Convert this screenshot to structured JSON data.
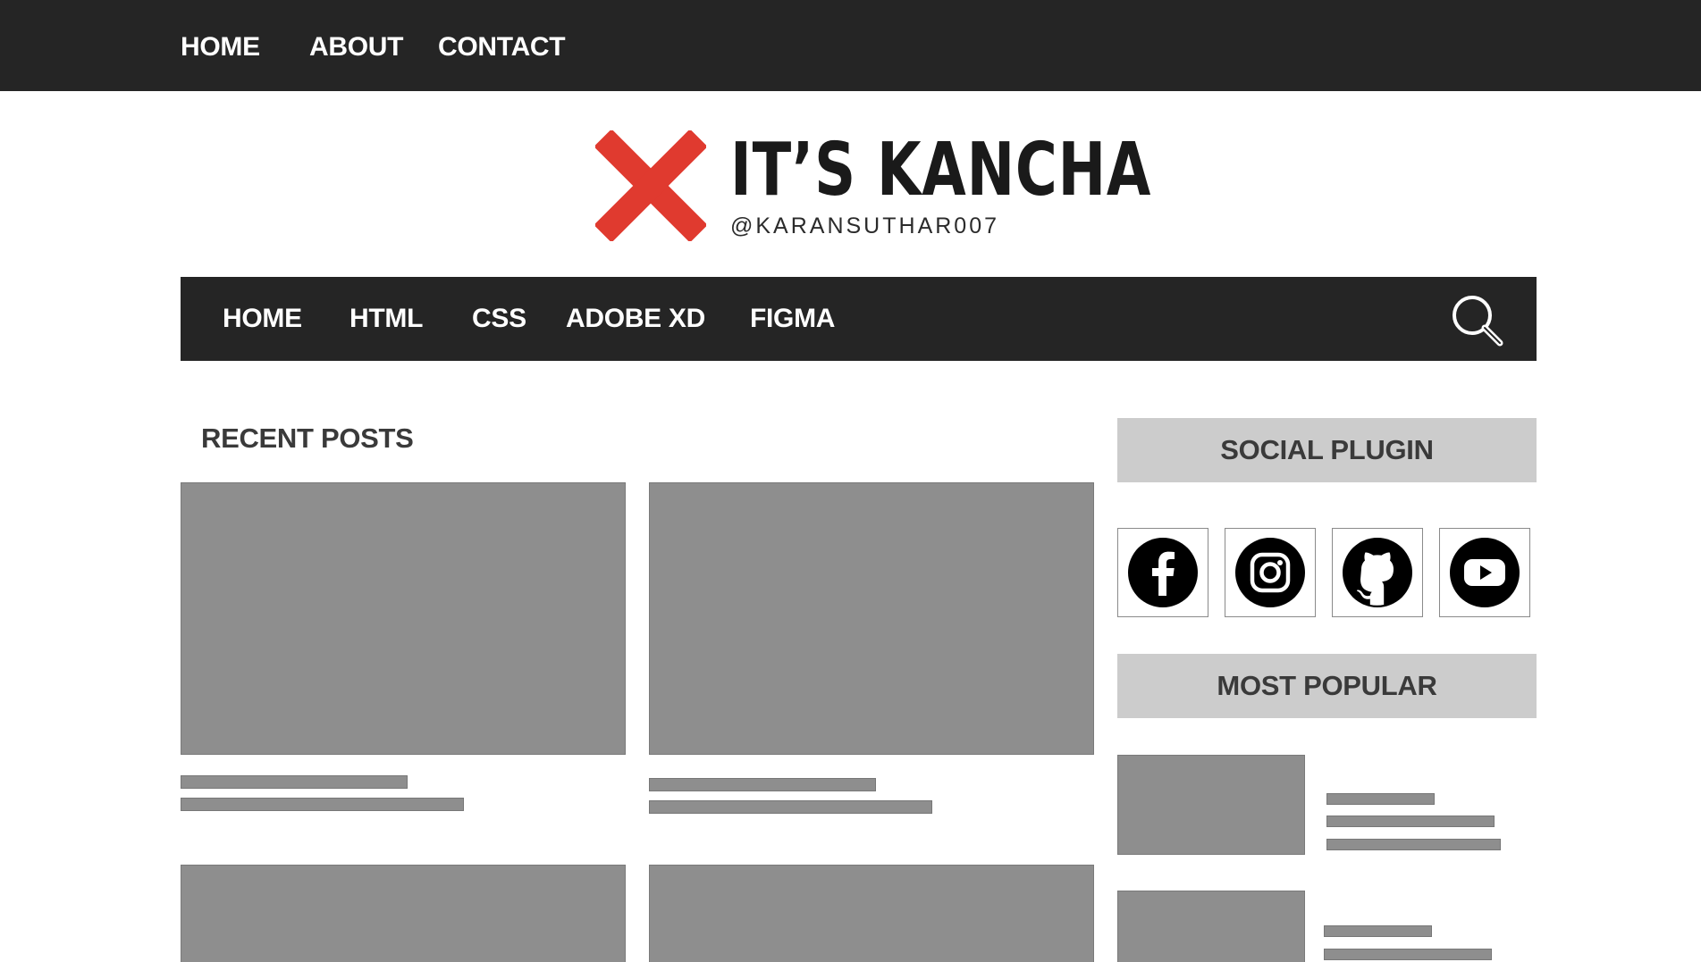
{
  "topbar": {
    "links": [
      "HOME",
      "ABOUT",
      "CONTACT"
    ]
  },
  "logo": {
    "title": "IT’S KANCHA",
    "handle": "@KARANSUTHAR007",
    "mark_color": "#e03a2f"
  },
  "mainnav": {
    "links": [
      "HOME",
      "HTML",
      "CSS",
      "ADOBE XD",
      "FIGMA"
    ],
    "search_icon": "search-icon"
  },
  "recent_posts": {
    "title": "RECENT POSTS"
  },
  "sidebar": {
    "social_title": "SOCIAL PLUGIN",
    "social_icons": [
      "facebook-icon",
      "instagram-icon",
      "github-icon",
      "youtube-icon"
    ],
    "popular_title": "MOST POPULAR"
  },
  "colors": {
    "dark_bar": "#252525",
    "placeholder": "#8e8e8e",
    "widget_header": "#cccccc"
  }
}
